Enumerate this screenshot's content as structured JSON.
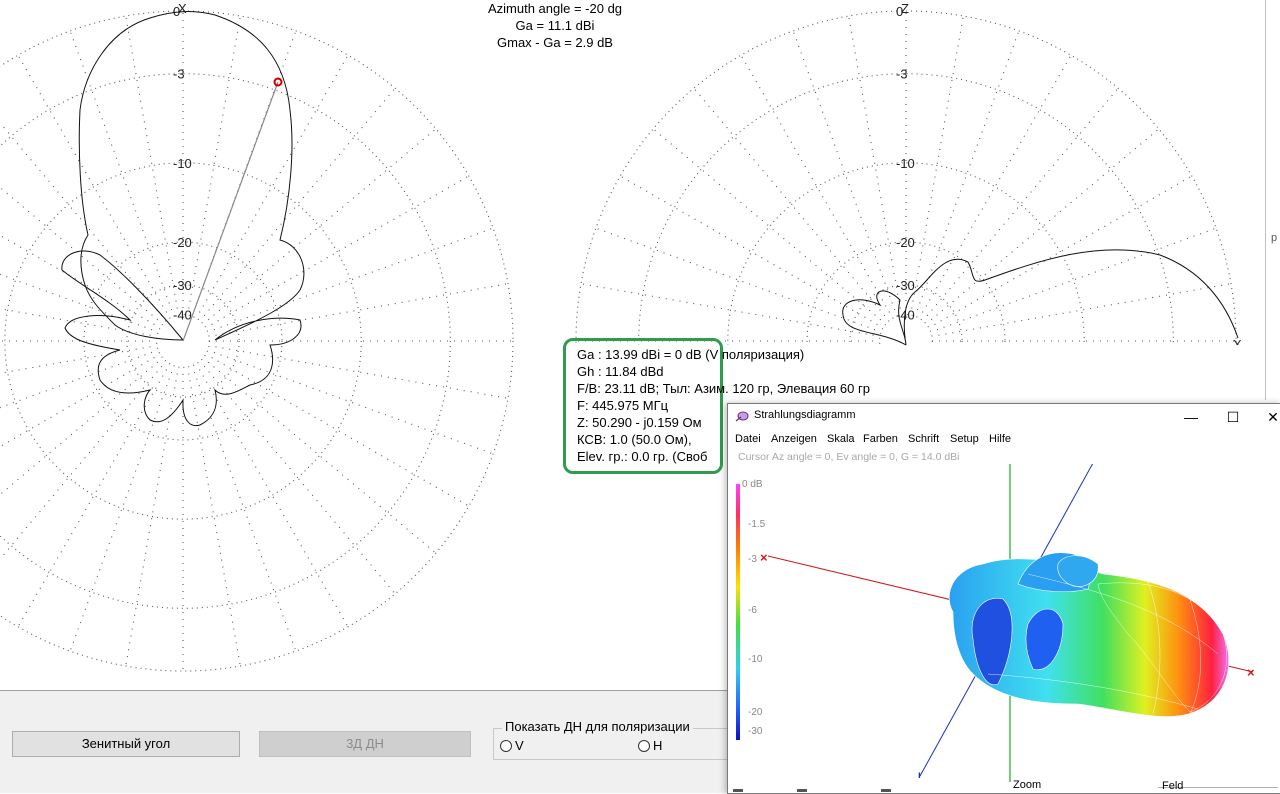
{
  "header": {
    "azimuth_line": "Azimuth angle = -20 dg",
    "ga_line": "Ga = 11.1 dBi",
    "gmax_line": "Gmax - Ga = 2.9 dB"
  },
  "plots": {
    "left": {
      "top_axis": "X",
      "ring_labels": [
        "0",
        "-3",
        "-10",
        "-20",
        "-30",
        "-40"
      ]
    },
    "right": {
      "top_axis": "Z",
      "ring_labels": [
        "0",
        "-3",
        "-10",
        "-20",
        "-30",
        "-40"
      ],
      "end_axis": "X"
    }
  },
  "info_panel": {
    "ga": "Ga : 13.99 dBi = 0 dB  (V поляризация)",
    "gh": "Gh : 11.84 dBd",
    "fb": "F/B: 23.11 dB; Тыл: Азим. 120 гр, Элевация 60 гр",
    "f": "F: 445.975 МГц",
    "z": "Z: 50.290 - j0.159 Ом",
    "kcb": "КСВ: 1.0 (50.0 Ом),",
    "elev": "Elev. гр.: 0.0 гр. (Своб"
  },
  "right_edge_text": "р",
  "bottom_panel": {
    "zenith_button": "Зенитный угол",
    "button_3d": "3Д  ДН",
    "polarization_group": "Показать ДН для поляризации",
    "radio_v": "V",
    "radio_h": "H"
  },
  "window_3d": {
    "title": "Strahlungsdiagramm",
    "controls": {
      "minimize": "—",
      "maximize": "☐",
      "close": "✕"
    },
    "menu": [
      "Datei",
      "Anzeigen",
      "Skala",
      "Farben",
      "Schrift",
      "Setup",
      "Hilfe"
    ],
    "cursor_info": "Cursor Az angle = 0,  Ev angle = 0,  G = 14.0 dBi",
    "scale_labels": [
      "0 dB",
      "-1.5",
      "-3",
      "-6",
      "-10",
      "-20",
      "-30"
    ],
    "zoom_label": "Zoom",
    "feld_label": "Feld",
    "colors": {
      "x_axis": "#d21b1b",
      "y_axis": "#1b2fbf",
      "z_axis": "#6ed36e"
    }
  },
  "colors": {
    "highlight_box": "#2e9b4d",
    "cursor_marker": "#cc0000",
    "grid": "#555555"
  }
}
